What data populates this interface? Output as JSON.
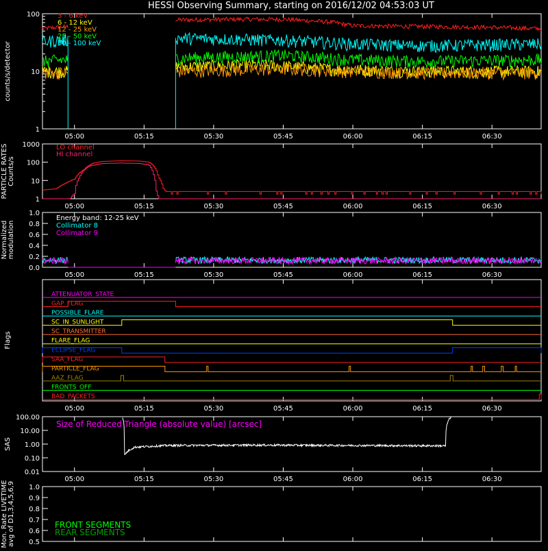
{
  "title": "HESSI Observing Summary, starting on 2016/12/02 04:53:03 UT",
  "time_axis": {
    "range_min": [
      -6.9,
      100.6
    ],
    "ticks": [
      {
        "min": 0,
        "label": "05:00"
      },
      {
        "min": 15,
        "label": "05:15"
      },
      {
        "min": 30,
        "label": "05:30"
      },
      {
        "min": 45,
        "label": "05:45"
      },
      {
        "min": 60,
        "label": "06:00"
      },
      {
        "min": 75,
        "label": "06:15"
      },
      {
        "min": 90,
        "label": "06:30"
      }
    ]
  },
  "chart_data": [
    {
      "type": "line",
      "panel": "count-rates",
      "ylabel": "counts/s/detector",
      "yscale": "log",
      "ylim": [
        1,
        100
      ],
      "yticks": [
        "1",
        "10",
        "100"
      ],
      "x_units": "minutes after 05:00 UT",
      "data_gap_minutes": [
        -1.4,
        21.8
      ],
      "series": [
        {
          "name": "3 - 6 keV",
          "color": "#ff2020",
          "points": [
            [
              -6.9,
              55
            ],
            [
              -1.4,
              60
            ],
            [
              21.8,
              78
            ],
            [
              35,
              80
            ],
            [
              45,
              80
            ],
            [
              55,
              72
            ],
            [
              60,
              62
            ],
            [
              75,
              60
            ],
            [
              90,
              58
            ],
            [
              100.6,
              55
            ]
          ]
        },
        {
          "name": "6 - 12 keV",
          "color": "#ffff00",
          "points": [
            [
              -6.9,
              10
            ],
            [
              -1.4,
              10
            ],
            [
              21.8,
              12
            ],
            [
              40,
              13
            ],
            [
              55,
              11
            ],
            [
              75,
              10
            ],
            [
              100.6,
              10
            ]
          ]
        },
        {
          "name": "12 - 25 keV",
          "color": "#ff9a00",
          "points": [
            [
              -6.9,
              9.5
            ],
            [
              -1.4,
              9.5
            ],
            [
              21.8,
              10
            ],
            [
              45,
              11
            ],
            [
              60,
              10
            ],
            [
              75,
              9.5
            ],
            [
              100.6,
              9.5
            ]
          ]
        },
        {
          "name": "25 - 50 keV",
          "color": "#00ff00",
          "points": [
            [
              -6.9,
              15
            ],
            [
              -1.4,
              16
            ],
            [
              21.8,
              17
            ],
            [
              45,
              19
            ],
            [
              60,
              16
            ],
            [
              75,
              15
            ],
            [
              100.6,
              16
            ]
          ]
        },
        {
          "name": "50 - 100 keV",
          "color": "#00ffff",
          "points": [
            [
              -6.9,
              33
            ],
            [
              -1.4,
              35
            ],
            [
              21.8,
              38
            ],
            [
              45,
              35
            ],
            [
              60,
              30
            ],
            [
              75,
              28
            ],
            [
              100.6,
              30
            ]
          ]
        }
      ]
    },
    {
      "type": "line",
      "panel": "particle-rates",
      "ylabel": "PARTICLE RATES Counts/s",
      "yscale": "log",
      "ylim": [
        1,
        1000
      ],
      "yticks": [
        "1",
        "10",
        "100",
        "1000"
      ],
      "x_units": "minutes after 05:00 UT",
      "series": [
        {
          "name": "LO channel",
          "color": "#ff2020",
          "points": [
            [
              -6.9,
              3
            ],
            [
              -4,
              3.5
            ],
            [
              -2,
              7
            ],
            [
              0,
              12
            ],
            [
              2,
              40
            ],
            [
              4,
              90
            ],
            [
              6,
              110
            ],
            [
              10,
              120
            ],
            [
              14,
              115
            ],
            [
              16,
              100
            ],
            [
              17,
              60
            ],
            [
              18,
              15
            ],
            [
              19,
              4
            ],
            [
              19.5,
              2.5
            ],
            [
              100.6,
              2.5
            ]
          ]
        },
        {
          "name": "HI channel",
          "color": "#ff2070",
          "points": [
            [
              -6.9,
              1
            ],
            [
              -1,
              1
            ],
            [
              0,
              2
            ],
            [
              1,
              15
            ],
            [
              3,
              60
            ],
            [
              6,
              85
            ],
            [
              10,
              90
            ],
            [
              14,
              85
            ],
            [
              16,
              70
            ],
            [
              17,
              20
            ],
            [
              17.5,
              3
            ],
            [
              18,
              1
            ],
            [
              100.6,
              1
            ]
          ]
        }
      ]
    },
    {
      "type": "line",
      "panel": "modulation",
      "ylabel": "Normalized modulation",
      "ylim": [
        0,
        1
      ],
      "yticks": [
        "0.0",
        "0.2",
        "0.4",
        "0.6",
        "0.8",
        "1.0"
      ],
      "annotations": [
        "Energy band: 12-25 keV"
      ],
      "series": [
        {
          "name": "Collimator 8",
          "color": "#00ffff",
          "level": 0.13
        },
        {
          "name": "Collimator 9",
          "color": "#ff00ff",
          "level": 0.12
        }
      ]
    },
    {
      "type": "line",
      "panel": "flags",
      "ylabel": "Flags",
      "series": [
        {
          "name": "ATTENUATOR_STATE",
          "color": "#ff00ff",
          "steps": []
        },
        {
          "name": "GAP_FLAG",
          "color": "#ff2020",
          "steps": [
            [
              -1.4,
              21.8
            ]
          ]
        },
        {
          "name": "POSSIBLE_FLARE",
          "color": "#00ffff",
          "steps": []
        },
        {
          "name": "SC_IN_SUNLIGHT",
          "color": "#ffff00",
          "steps": [
            [
              10.2,
              81.5
            ]
          ]
        },
        {
          "name": "SC_TRANSMITTER",
          "color": "#ff7030",
          "steps": []
        },
        {
          "name": "FLARE_FLAG",
          "color": "#ffff00",
          "steps": []
        },
        {
          "name": "ECLIPSE_FLAG",
          "color": "#0040ff",
          "steps": [
            [
              -6.9,
              10.2
            ],
            [
              81.5,
              100.6
            ]
          ]
        },
        {
          "name": "SAA_FLAG",
          "color": "#ff2020",
          "steps": [
            [
              -6.9,
              19.5
            ]
          ]
        },
        {
          "name": "PARTICLE_FLAG",
          "color": "#ff9a00",
          "steps": [
            [
              -6.9,
              19.5
            ],
            [
              28.5,
              28.8
            ],
            [
              59.2,
              59.5
            ],
            [
              85.5,
              85.8
            ],
            [
              88,
              88.4
            ],
            [
              92,
              92.4
            ],
            [
              95,
              95.3
            ]
          ]
        },
        {
          "name": "AAZ_FLAG",
          "color": "#a08000",
          "steps": [
            [
              10.0,
              10.6
            ],
            [
              81.0,
              81.6
            ]
          ]
        },
        {
          "name": "FRONTS_OFF",
          "color": "#00ff00",
          "steps": []
        },
        {
          "name": "BAD_PACKETS",
          "color": "#ff2020",
          "steps": [
            [
              100.2,
              100.6
            ]
          ]
        }
      ]
    },
    {
      "type": "line",
      "panel": "sas",
      "ylabel": "SAS",
      "yscale": "log",
      "ylim": [
        0.01,
        100
      ],
      "yticks": [
        "0.01",
        "0.10",
        "1.00",
        "10.00",
        "100.00"
      ],
      "annotations": [
        "Size of Reduced Triangle (absolute value) [arcsec]"
      ],
      "series": [
        {
          "name": "Size of Reduced Triangle",
          "color": "#ffffff",
          "points": [
            [
              10.3,
              100
            ],
            [
              10.8,
              0.15
            ],
            [
              11.5,
              0.3
            ],
            [
              13,
              0.6
            ],
            [
              20,
              0.8
            ],
            [
              40,
              0.85
            ],
            [
              60,
              0.8
            ],
            [
              80,
              0.75
            ],
            [
              81.2,
              100
            ]
          ]
        }
      ]
    },
    {
      "type": "line",
      "panel": "livetime",
      "ylabel": "Mon. Rate LIVETIME avg of D1,3,4,5,6,9",
      "ylim": [
        0.5,
        1.0
      ],
      "yticks": [
        "0.5",
        "0.6",
        "0.7",
        "0.8",
        "0.9",
        "1.0"
      ],
      "series": [
        {
          "name": "FRONT SEGMENTS",
          "color": "#00ff00",
          "points": []
        },
        {
          "name": "REAR SEGMENTS",
          "color": "#00a000",
          "points": []
        }
      ]
    }
  ]
}
